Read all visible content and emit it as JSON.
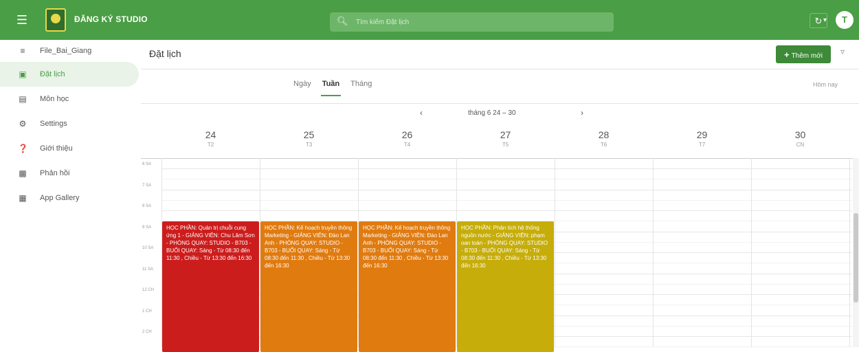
{
  "topbar": {
    "app_title": "ĐĂNG KÝ STUDIO",
    "search_placeholder": "Tìm kiếm Đặt lịch",
    "avatar_letter": "T",
    "accent_color": "#4a9e45"
  },
  "sidebar": {
    "items": [
      {
        "label": "File_Bai_Giang",
        "icon": "list-icon"
      },
      {
        "label": "Đặt lịch",
        "icon": "calendar-icon"
      },
      {
        "label": "Môn học",
        "icon": "form-icon"
      },
      {
        "label": "Settings",
        "icon": "gear-icon"
      },
      {
        "label": "Giới thiệu",
        "icon": "info-icon"
      },
      {
        "label": "Phản hồi",
        "icon": "feedback-icon"
      },
      {
        "label": "App Gallery",
        "icon": "grid-icon"
      }
    ]
  },
  "main": {
    "title": "Đặt lịch",
    "add_label": "Thêm mới",
    "views": [
      "Ngày",
      "Tuần",
      "Tháng"
    ],
    "selected_view": "Tuần",
    "today_label": "Hôm nay",
    "week_label": "tháng 6 24 – 30",
    "days": [
      {
        "num": "24",
        "wd": "T2"
      },
      {
        "num": "25",
        "wd": "T3"
      },
      {
        "num": "26",
        "wd": "T4"
      },
      {
        "num": "27",
        "wd": "T5"
      },
      {
        "num": "28",
        "wd": "T6"
      },
      {
        "num": "29",
        "wd": "T7"
      },
      {
        "num": "30",
        "wd": "CN"
      }
    ],
    "times": [
      "6 SA",
      "7 SA",
      "8 SA",
      "9 SA",
      "10 SA",
      "11 SA",
      "12 CH",
      "1 CH",
      "2 CH"
    ]
  },
  "events": [
    {
      "day": 0,
      "color": "#cc1d1d",
      "text": "HỌC PHẦN: Quản trị chuỗi cung ứng 1 - GIẢNG VIÊN: Chu Lâm Sơn - PHÒNG QUAY: STUDIO - B703 - BUỔI QUAY: Sáng - Từ 08:30 đến 11:30 , Chiều - Từ 13:30 đến 16:30"
    },
    {
      "day": 1,
      "color": "#e07b10",
      "text": "HỌC PHẦN: Kế hoạch truyền thông Marketing - GIẢNG VIÊN: Đào Lan Anh - PHÒNG QUAY: STUDIO - B703 - BUỔI QUAY: Sáng - Từ 08:30 đến 11:30 , Chiều - Từ 13:30 đến 16:30"
    },
    {
      "day": 2,
      "color": "#e07b10",
      "text": "HỌC PHẦN: Kế hoạch truyền thông Marketing - GIẢNG VIÊN: Đào Lan Anh - PHÒNG QUAY: STUDIO - B703 - BUỔI QUAY: Sáng - Từ 08:30 đến 11:30 , Chiều - Từ 13:30 đến 16:30"
    },
    {
      "day": 3,
      "color": "#c6ad0a",
      "text": "HỌC PHẦN: Phân tích hệ thống nguồn nước - GIẢNG VIÊN: phạm oan toàn - PHÒNG QUAY: STUDIO - B703 - BUỔI QUAY: Sáng - Từ 08:30 đến 11:30 , Chiều - Từ 13:30 đến 16:30"
    }
  ]
}
